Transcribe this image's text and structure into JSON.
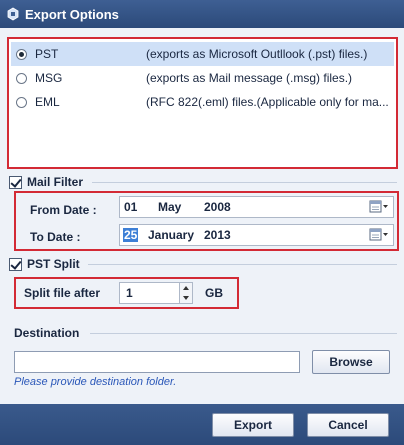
{
  "window": {
    "title": "Export Options"
  },
  "export_options": [
    {
      "name": "PST",
      "description": "(exports as Microsoft Outllook (.pst) files.)",
      "selected": true
    },
    {
      "name": "MSG",
      "description": "(exports as Mail message (.msg) files.)",
      "selected": false
    },
    {
      "name": "EML",
      "description": "(RFC 822(.eml) files.(Applicable only for ma...",
      "selected": false
    }
  ],
  "mail_filter": {
    "label": "Mail Filter",
    "checked": true,
    "from": {
      "label": "From Date :",
      "day": "01",
      "month": "May",
      "year": "2008"
    },
    "to": {
      "label": "To Date :",
      "day": "25",
      "month": "January",
      "year": "2013"
    }
  },
  "pst_split": {
    "label": "PST Split",
    "checked": true,
    "field_label": "Split file after",
    "value": "1",
    "unit": "GB"
  },
  "destination": {
    "label": "Destination",
    "path_value": "",
    "browse_label": "Browse",
    "hint": "Please provide destination folder."
  },
  "footer": {
    "export_label": "Export",
    "cancel_label": "Cancel"
  },
  "colors": {
    "title_bar": "#2c4a7a",
    "highlight_border": "#d32a35",
    "selection": "#cfe0f7",
    "hint_text": "#2a57b8"
  }
}
